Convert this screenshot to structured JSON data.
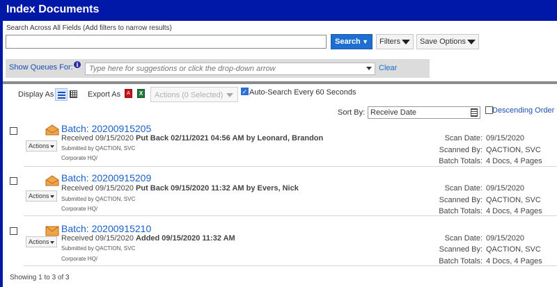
{
  "header": {
    "title": "Index Documents"
  },
  "search": {
    "label": "Search Across All Fields (Add filters to narrow results)",
    "value": "",
    "search_label": "Search",
    "filters_label": "Filters",
    "save_options_label": "Save Options"
  },
  "queues": {
    "label": "Show Queues For:",
    "placeholder": "Type here for suggestions or click the drop-down arrow",
    "clear_label": "Clear"
  },
  "toolbar": {
    "display_as_label": "Display As",
    "export_as_label": "Export As",
    "pdf_glyph": "A",
    "xls_glyph": "X",
    "actions_selected_label": "Actions (0 Selected)",
    "autosearch_label": "Auto-Search Every 60 Seconds",
    "autosearch_checked": true
  },
  "sort": {
    "label": "Sort By:",
    "selected": "Receive Date",
    "descending_label": "Descending Order",
    "descending_checked": false
  },
  "batches": [
    {
      "title": "Batch: 20200915205",
      "received": "Received 09/15/2020",
      "status": "Put Back 02/11/2021 04:56 AM by Leonard, Brandon",
      "submitted_by": "Submitted by QACTION, SVC",
      "location": "Corporate HQ/",
      "actions_label": "Actions",
      "scan_date_label": "Scan Date:",
      "scan_date": "09/15/2020",
      "scanned_by_label": "Scanned By:",
      "scanned_by": "QACTION, SVC",
      "totals_label": "Batch Totals:",
      "totals": "4 Docs, 4 Pages",
      "icon": "open-envelope-icon"
    },
    {
      "title": "Batch: 20200915209",
      "received": "Received 09/15/2020",
      "status": "Put Back 09/15/2020 11:32 AM by Evers, Nick",
      "submitted_by": "Submitted by QACTION, SVC",
      "location": "Corporate HQ/",
      "actions_label": "Actions",
      "scan_date_label": "Scan Date:",
      "scan_date": "09/15/2020",
      "scanned_by_label": "Scanned By:",
      "scanned_by": "QACTION, SVC",
      "totals_label": "Batch Totals:",
      "totals": "4 Docs, 4 Pages",
      "icon": "open-envelope-icon"
    },
    {
      "title": "Batch: 20200915210",
      "received": "Received 09/15/2020",
      "status": "Added 09/15/2020 11:32 AM",
      "submitted_by": "Submitted by QACTION, SVC",
      "location": "Corporate HQ/",
      "actions_label": "Actions",
      "scan_date_label": "Scan Date:",
      "scan_date": "09/15/2020",
      "scanned_by_label": "Scanned By:",
      "scanned_by": "QACTION, SVC",
      "totals_label": "Batch Totals:",
      "totals": "4 Docs, 4 Pages",
      "icon": "closed-envelope-icon"
    }
  ],
  "footer": {
    "showing": "Showing 1 to 3 of 3"
  },
  "colors": {
    "header_bg": "#0018a8",
    "accent": "#1f6fd1",
    "link": "#1a5fc8",
    "envelope": "#f0a54a"
  }
}
